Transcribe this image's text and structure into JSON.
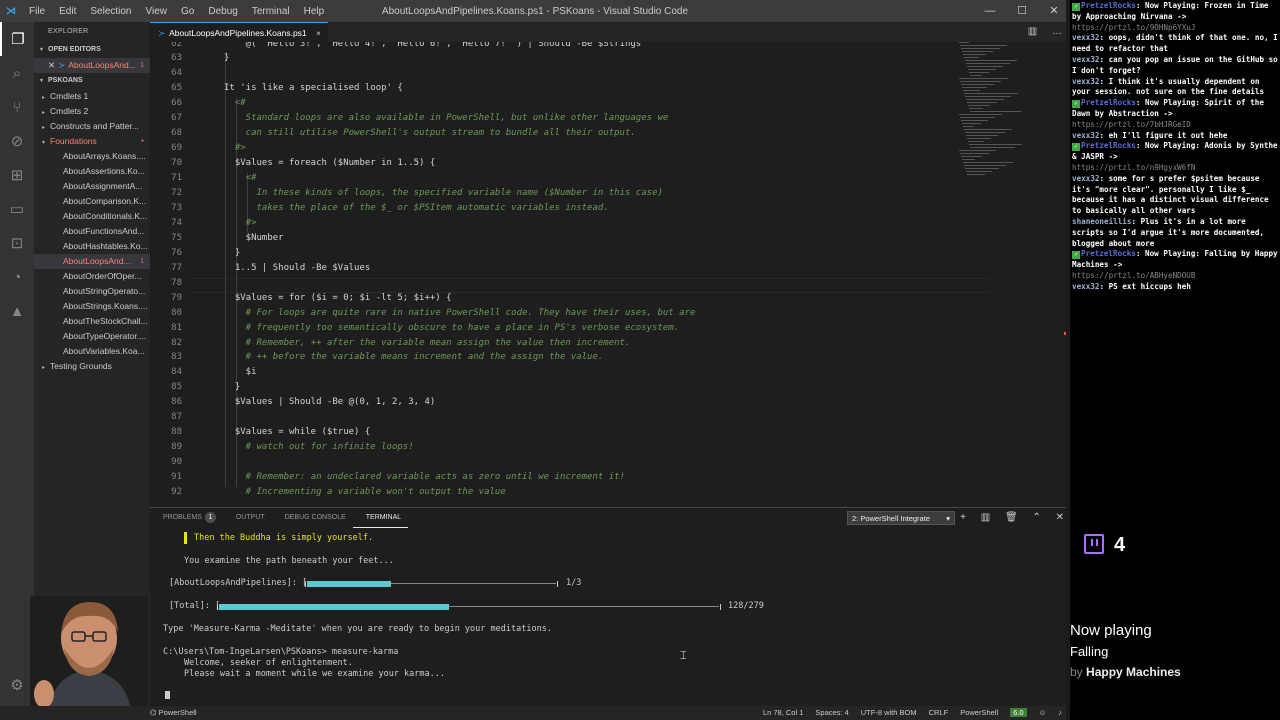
{
  "window": {
    "title": "AboutLoopsAndPipelines.Koans.ps1 - PSKoans - Visual Studio Code",
    "menu": [
      "File",
      "Edit",
      "Selection",
      "View",
      "Go",
      "Debug",
      "Terminal",
      "Help"
    ]
  },
  "sidebar": {
    "title": "EXPLORER",
    "open_editors_label": "OPEN EDITORS",
    "open_file": "AboutLoopsAnd...",
    "open_file_count": "1",
    "project_label": "PSKOANS",
    "tree": [
      {
        "label": "Cmdlets 1",
        "type": "folder"
      },
      {
        "label": "Cmdlets 2",
        "type": "folder"
      },
      {
        "label": "Constructs and Patter...",
        "type": "folder"
      },
      {
        "label": "Foundations",
        "type": "folder-open",
        "modified": true
      },
      {
        "label": "AboutArrays.Koans....",
        "type": "file"
      },
      {
        "label": "AboutAssertions.Ko...",
        "type": "file"
      },
      {
        "label": "AboutAssignmentA...",
        "type": "file"
      },
      {
        "label": "AboutComparison.K...",
        "type": "file"
      },
      {
        "label": "AboutConditionals.K...",
        "type": "file"
      },
      {
        "label": "AboutFunctionsAnd...",
        "type": "file"
      },
      {
        "label": "AboutHashtables.Ko...",
        "type": "file"
      },
      {
        "label": "AboutLoopsAnd...",
        "type": "file",
        "selected": true,
        "badge": "1"
      },
      {
        "label": "AboutOrderOfOper...",
        "type": "file"
      },
      {
        "label": "AboutStringOperato...",
        "type": "file"
      },
      {
        "label": "AboutStrings.Koans....",
        "type": "file"
      },
      {
        "label": "AboutTheStockChall...",
        "type": "file"
      },
      {
        "label": "AboutTypeOperator....",
        "type": "file"
      },
      {
        "label": "AboutVariables.Koa...",
        "type": "file"
      },
      {
        "label": "Testing Grounds",
        "type": "folder"
      }
    ]
  },
  "tab": {
    "label": "AboutLoopsAndPipelines.Koans.ps1",
    "close": "×"
  },
  "editor": {
    "lines": [
      {
        "n": "62",
        "ind": 6,
        "t": "@( 'Hello 3!', 'Hello 4!', 'Hello 6!', 'Hello 7!' ) | Should -Be $Strings",
        "c": "code"
      },
      {
        "n": "63",
        "ind": 2,
        "t": "}",
        "c": "code"
      },
      {
        "n": "64",
        "ind": 0,
        "t": "",
        "c": "code"
      },
      {
        "n": "65",
        "ind": 2,
        "t": "It 'is like a specialised loop' {",
        "c": "code"
      },
      {
        "n": "66",
        "ind": 4,
        "t": "<#",
        "c": "cmt"
      },
      {
        "n": "67",
        "ind": 6,
        "t": "Standard loops are also available in PowerShell, but unlike other languages we",
        "c": "cmt"
      },
      {
        "n": "68",
        "ind": 6,
        "t": "can still utilise PowerShell's output stream to bundle all their output.",
        "c": "cmt"
      },
      {
        "n": "69",
        "ind": 4,
        "t": "#>",
        "c": "cmt"
      },
      {
        "n": "70",
        "ind": 4,
        "t": "$Values = foreach ($Number in 1..5) {",
        "c": "code"
      },
      {
        "n": "71",
        "ind": 6,
        "t": "<#",
        "c": "cmt"
      },
      {
        "n": "72",
        "ind": 8,
        "t": "In these kinds of loops, the specified variable name ($Number in this case)",
        "c": "cmt"
      },
      {
        "n": "73",
        "ind": 8,
        "t": "takes the place of the $_ or $PSItem automatic variables instead.",
        "c": "cmt"
      },
      {
        "n": "74",
        "ind": 6,
        "t": "#>",
        "c": "cmt"
      },
      {
        "n": "75",
        "ind": 6,
        "t": "$Number",
        "c": "code"
      },
      {
        "n": "76",
        "ind": 4,
        "t": "}",
        "c": "code"
      },
      {
        "n": "77",
        "ind": 4,
        "t": "1..5 | Should -Be $Values",
        "c": "code"
      },
      {
        "n": "78",
        "ind": 0,
        "t": "",
        "c": "code"
      },
      {
        "n": "79",
        "ind": 4,
        "t": "$Values = for ($i = 0; $i -lt 5; $i++) {",
        "c": "code"
      },
      {
        "n": "80",
        "ind": 6,
        "t": "# For loops are quite rare in native PowerShell code. They have their uses, but are",
        "c": "cmt"
      },
      {
        "n": "81",
        "ind": 6,
        "t": "# frequently too semantically obscure to have a place in PS's verbose ecosystem.",
        "c": "cmt"
      },
      {
        "n": "82",
        "ind": 6,
        "t": "# Remember, ++ after the variable mean assign the value then increment.",
        "c": "cmt"
      },
      {
        "n": "83",
        "ind": 6,
        "t": "# ++ before the variable means increment and the assign the value.",
        "c": "cmt"
      },
      {
        "n": "84",
        "ind": 6,
        "t": "$i",
        "c": "code"
      },
      {
        "n": "85",
        "ind": 4,
        "t": "}",
        "c": "code"
      },
      {
        "n": "86",
        "ind": 4,
        "t": "$Values | Should -Be @(0, 1, 2, 3, 4)",
        "c": "code"
      },
      {
        "n": "87",
        "ind": 0,
        "t": "",
        "c": "code"
      },
      {
        "n": "88",
        "ind": 4,
        "t": "$Values = while ($true) {",
        "c": "code"
      },
      {
        "n": "89",
        "ind": 6,
        "t": "# watch out for infinite loops!",
        "c": "cmt"
      },
      {
        "n": "90",
        "ind": 0,
        "t": "",
        "c": "code"
      },
      {
        "n": "91",
        "ind": 6,
        "t": "# Remember: an undeclared variable acts as zero until we increment it!",
        "c": "cmt"
      },
      {
        "n": "92",
        "ind": 6,
        "t": "# Incrementing a variable won't output the value",
        "c": "cmt"
      }
    ]
  },
  "panel": {
    "tabs": [
      "PROBLEMS",
      "OUTPUT",
      "DEBUG CONSOLE",
      "TERMINAL"
    ],
    "problems_count": "1",
    "terminal_select": "2: PowerShell Integrate",
    "terminal": {
      "quote": "Then the Buddha is simply yourself.",
      "examine": "You examine the path beneath your feet...",
      "topic_label": "[AboutLoopsAndPipelines]: [",
      "topic_end": "]",
      "topic_progress": "1/3",
      "topic_fraction": 0.333,
      "total_label": "[Total]: [",
      "total_end": "]",
      "total_progress": "128/279",
      "total_fraction": 0.459,
      "meditate": "Type 'Measure-Karma -Meditate' when you are ready to begin your meditations.",
      "prompt": "C:\\Users\\Tom-IngeLarsen\\PSKoans> measure-karma",
      "welcome": "Welcome, seeker of enlightenment.",
      "wait": "Please wait a moment while we examine your karma..."
    }
  },
  "statusbar": {
    "left": "PowerShell",
    "items": [
      "Ln 78, Col 1",
      "Spaces: 4",
      "UTF-8 with BOM",
      "CRLF",
      "PowerShell"
    ],
    "ps_version": "6.0"
  },
  "chat": {
    "messages": [
      {
        "user": "PretzelRocks",
        "bot": true,
        "text": "Now Playing: Frozen in Time by Approaching Nirvana ->",
        "link": "https://prtzl.to/9OHNp6YXuJ"
      },
      {
        "user": "vexx32",
        "text": "oops, didn't think of that one. no, I need to refactor that"
      },
      {
        "user": "vexx32",
        "text": "can you pop an issue on the GitHub so I don't forget?"
      },
      {
        "user": "vexx32",
        "text": "I think it's usually dependent on your session. not sure on the fine details"
      },
      {
        "user": "PretzelRocks",
        "bot": true,
        "text": "Now Playing: Spirit of the Dawn by Abstraction ->",
        "link": "https://prtzl.to/7bHJRGeID"
      },
      {
        "user": "vexx32",
        "text": "eh I'll figure it out hehe"
      },
      {
        "user": "PretzelRocks",
        "bot": true,
        "text": "Now Playing: Adonis by Synthe & JASPR ->",
        "link": "https://prtzl.to/n9HgyxW6fN"
      },
      {
        "user": "vexx32",
        "text": "some for s prefer $psitem because it's \"more clear\". personally I like $_ because it has a distinct visual difference to basically all other vars"
      },
      {
        "user": "shaneoneillis",
        "text": "Plus it's in a lot more scripts so I'd argue it's more documented, blogged about more"
      },
      {
        "user": "PretzelRocks",
        "bot": true,
        "text": "Now Playing: Falling by Happy Machines ->",
        "link": "https://prtzl.to/ABHyeNDOUB"
      },
      {
        "user": "vexx32",
        "text": "PS ext hiccups heh"
      }
    ],
    "viewer_count": "4",
    "now_playing_label": "Now playing",
    "song": "Falling",
    "by_label": "by",
    "artist": "Happy Machines"
  },
  "colors": {
    "accent": "#3b9fe6",
    "comment": "#6a9955",
    "progress": "#5cc8cf",
    "twitch": "#a970ff",
    "bot": "#5a6ed8"
  }
}
